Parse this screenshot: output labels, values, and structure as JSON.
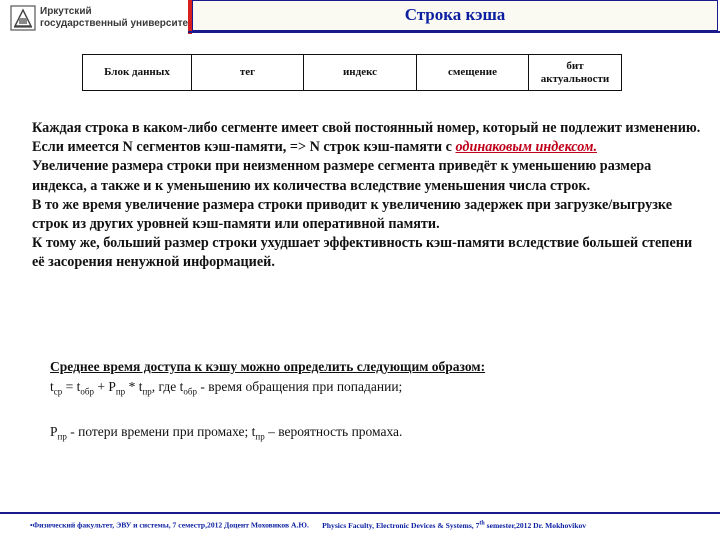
{
  "header": {
    "university_line1": "Иркутский",
    "university_line2": "государственный университет",
    "title": "Строка кэша"
  },
  "fields_table": {
    "cells": [
      "Блок данных",
      "тег",
      "индекс",
      "смещение",
      "бит актуальности"
    ]
  },
  "bullets": [
    {
      "mark": "",
      "text": "Каждая строка в каком-либо сегменте имеет свой постоянный номер, который не подлежит изменению."
    },
    {
      "mark": "",
      "text": "Если имеется N сегментов кэш-памяти, => N строк кэш-памяти с ",
      "emphasis": "одинаковым индексом."
    },
    {
      "mark": "",
      "text": "Увеличение размера строки при неизменном размере сегмента приведёт к уменьшению размера индекса, а также и к уменьшению их количества вследствие уменьшения числа строк."
    },
    {
      "mark": "",
      "text": "В то же время увеличение размера строки приводит к увеличению задержек при загрузке/выгрузке строк из других уровней кэш-памяти или оперативной памяти."
    },
    {
      "mark": "",
      "text": " К тому же, больший размер строки ухудшает эффективность кэш-памяти вследствие большей степени её засорения ненужной информацией."
    }
  ],
  "formula": {
    "heading": "Среднее время доступа к кэшу можно определить следующим образом:",
    "t": "t",
    "sub_cp": "ср",
    "eq": " = t",
    "sub_obr": "обр",
    "plus": " + P",
    "sub_pr": "пр",
    "times": " * t",
    "sub_pr2": "пр",
    "where": ", где t",
    "sub_obr2": "обр",
    "where_desc": " - время обращения при попадании;",
    "p_line_P": "P",
    "p_line_sub": "пр",
    "p_line_desc1": " - потери времени при промахе; t",
    "p_line_sub2": "пр",
    "p_line_desc2": " – вероятность промаха."
  },
  "footer": {
    "text_ru": "•Физический факультет, ЭВУ и системы, 7 семестр,2012 Доцент Моховиков А.Ю.",
    "text_en_pre": "Physics Faculty, Electronic Devices & Systems, 7",
    "text_en_sup": "th",
    "text_en_post": " semester,2012   Dr. Mokhovikov"
  },
  "colors": {
    "title": "#0b1fa0",
    "accent_red": "#d81e1e",
    "emphasis": "#c0001a"
  }
}
